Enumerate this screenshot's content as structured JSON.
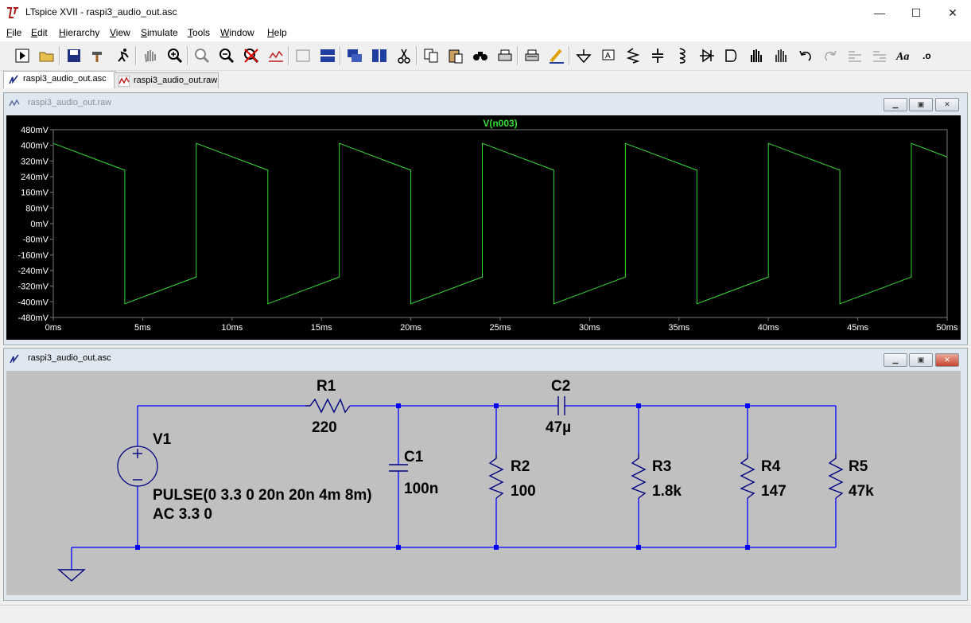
{
  "window": {
    "title": "LTspice XVII - raspi3_audio_out.asc",
    "minimize": "—",
    "maximize": "☐",
    "close": "✕"
  },
  "menu": [
    {
      "label": "File",
      "ul": "F",
      "rest": "ile"
    },
    {
      "label": "Edit",
      "ul": "E",
      "rest": "dit"
    },
    {
      "label": "Hierarchy",
      "ul": "H",
      "rest": "ierarchy"
    },
    {
      "label": "View",
      "ul": "V",
      "rest": "iew"
    },
    {
      "label": "Simulate",
      "ul": "S",
      "rest": "imulate"
    },
    {
      "label": "Tools",
      "ul": "T",
      "rest": "ools"
    },
    {
      "label": "Window",
      "ul": "W",
      "rest": "indow"
    },
    {
      "label": "Help",
      "ul": "H",
      "rest": "elp"
    }
  ],
  "toolbar": {
    "icons": [
      "run-icon",
      "open-folder-icon",
      "save-icon",
      "control-panel-hammer-icon",
      "run-halt-icon",
      "pan-hand-icon",
      "zoom-in-icon",
      "zoom-area-icon",
      "zoom-out-icon",
      "zoom-cancel-icon",
      "autorange-icon",
      "frame-plot-icon",
      "tile-horizontal-icon",
      "cascade-icon",
      "tile-vertical-icon",
      "cut-icon",
      "copy-icon",
      "paste-icon",
      "find-icon",
      "print-setup-icon",
      "print-icon",
      "draw-wire-icon",
      "ground-icon",
      "net-label-icon",
      "resistor-icon",
      "capacitor-icon",
      "inductor-icon",
      "diode-icon",
      "component-icon",
      "move-icon",
      "drag-icon",
      "undo-icon",
      "redo-icon",
      "rotate-icon",
      "mirror-icon",
      "text-icon",
      "spice-directive-icon"
    ]
  },
  "tabs": [
    {
      "label": "raspi3_audio_out.asc",
      "icon": "schematic-icon",
      "active": true
    },
    {
      "label": "raspi3_audio_out.raw",
      "icon": "waveform-icon",
      "active": false
    }
  ],
  "plot_window": {
    "title": "raspi3_audio_out.raw"
  },
  "schematic_window": {
    "title": "raspi3_audio_out.asc"
  },
  "mdi_buttons": {
    "min": "▁",
    "max": "▣",
    "close": "✕"
  },
  "colors": {
    "trace": "#33dd33",
    "grid": "#7a7a7a",
    "axis_text": "#ffffff",
    "wire": "#0000ff",
    "junction": "#0000ff",
    "schematic_bg": "#c0c0c0",
    "plot_bg": "#000000"
  },
  "chart_data": {
    "type": "line",
    "title": "V(n003)",
    "xlabel": "",
    "ylabel": "",
    "xlim": [
      0,
      50
    ],
    "ylim": [
      -480,
      480
    ],
    "x_ticks": [
      "0ms",
      "5ms",
      "10ms",
      "15ms",
      "20ms",
      "25ms",
      "30ms",
      "35ms",
      "40ms",
      "45ms",
      "50ms"
    ],
    "y_ticks": [
      "480mV",
      "400mV",
      "320mV",
      "240mV",
      "160mV",
      "80mV",
      "0mV",
      "-80mV",
      "-160mV",
      "-240mV",
      "-320mV",
      "-400mV",
      "-480mV"
    ],
    "series": [
      {
        "name": "V(n003)",
        "x_unit": "ms",
        "y_unit": "mV",
        "points": [
          [
            0,
            410
          ],
          [
            4,
            273
          ],
          [
            4,
            -410
          ],
          [
            8,
            -273
          ],
          [
            8,
            410
          ],
          [
            12,
            273
          ],
          [
            12,
            -410
          ],
          [
            16,
            -273
          ],
          [
            16,
            410
          ],
          [
            20,
            273
          ],
          [
            20,
            -410
          ],
          [
            24,
            -273
          ],
          [
            24,
            410
          ],
          [
            28,
            273
          ],
          [
            28,
            -410
          ],
          [
            32,
            -273
          ],
          [
            32,
            410
          ],
          [
            36,
            273
          ],
          [
            36,
            -410
          ],
          [
            40,
            -273
          ],
          [
            40,
            410
          ],
          [
            44,
            273
          ],
          [
            44,
            -410
          ],
          [
            48,
            -273
          ],
          [
            48,
            410
          ],
          [
            50,
            340
          ]
        ]
      }
    ]
  },
  "schematic": {
    "components": [
      {
        "ref": "V1",
        "value1": "PULSE(0 3.3 0 20n 20n 4m 8m)",
        "value2": "AC 3.3 0"
      },
      {
        "ref": "R1",
        "value": "220"
      },
      {
        "ref": "C1",
        "value": "100n"
      },
      {
        "ref": "R2",
        "value": "100"
      },
      {
        "ref": "C2",
        "value": "47µ"
      },
      {
        "ref": "R3",
        "value": "1.8k"
      },
      {
        "ref": "R4",
        "value": "147"
      },
      {
        "ref": "R5",
        "value": "47k"
      }
    ]
  }
}
